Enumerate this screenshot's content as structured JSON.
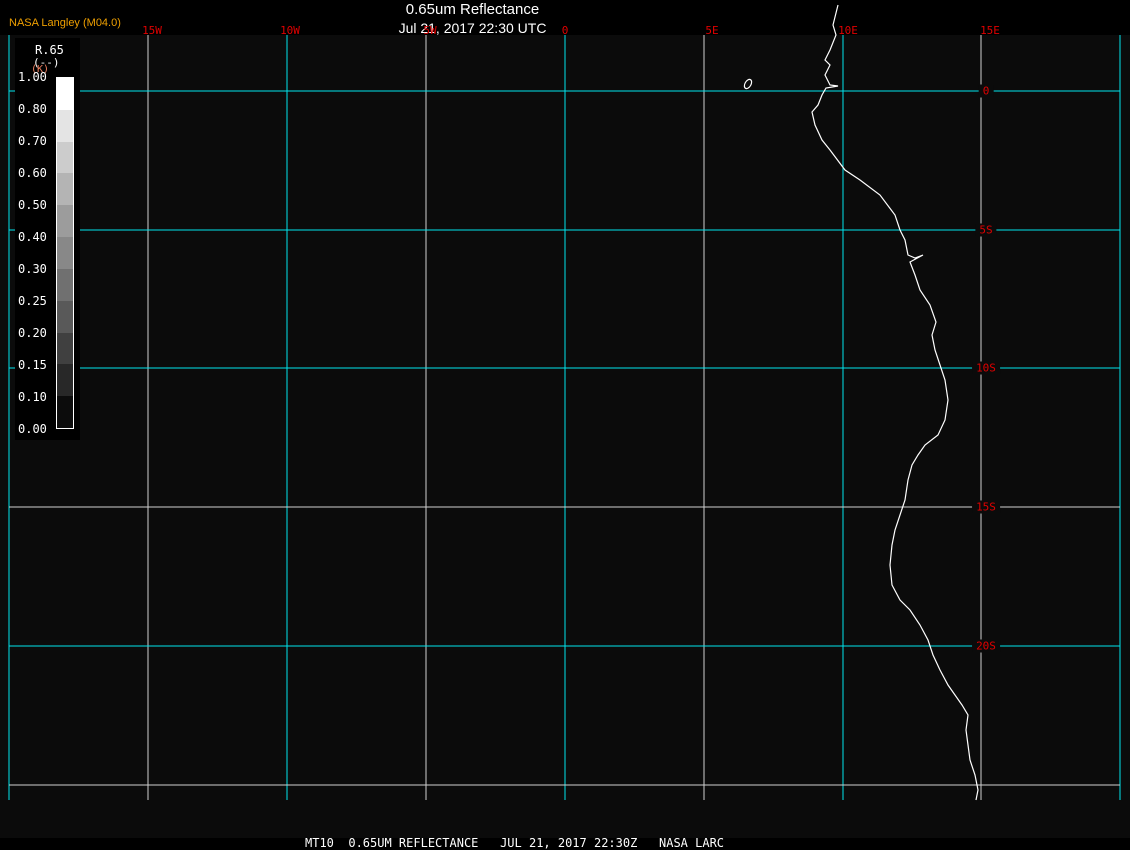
{
  "header": {
    "title": "0.65um Reflectance",
    "datetime": "Jul 21, 2017 22:30 UTC",
    "provider": "NASA Langley (M04.0)"
  },
  "map": {
    "longitude_labels": [
      "15W",
      "10W",
      "5W",
      "0",
      "5E",
      "10E",
      "15E"
    ],
    "latitude_labels": [
      "0",
      "5S",
      "10S",
      "15S",
      "20S"
    ],
    "grid_color": "#00e5ee",
    "label_color": "#e00000",
    "coastline_color": "#ffffff"
  },
  "legend": {
    "variable": "R.65",
    "units": "(--)",
    "unit_marker": "(K)",
    "ticks": [
      "1.00",
      "0.80",
      "0.70",
      "0.60",
      "0.50",
      "0.40",
      "0.30",
      "0.25",
      "0.20",
      "0.15",
      "0.10",
      "0.00"
    ],
    "colors": [
      "#ffffff",
      "#e4e4e4",
      "#cccccc",
      "#b4b4b4",
      "#9c9c9c",
      "#888888",
      "#707070",
      "#595959",
      "#404040",
      "#282828",
      "#0c0c0c"
    ]
  },
  "footer": "MT10  0.65UM REFLECTANCE   JUL 21, 2017 22:30Z   NASA LARC"
}
